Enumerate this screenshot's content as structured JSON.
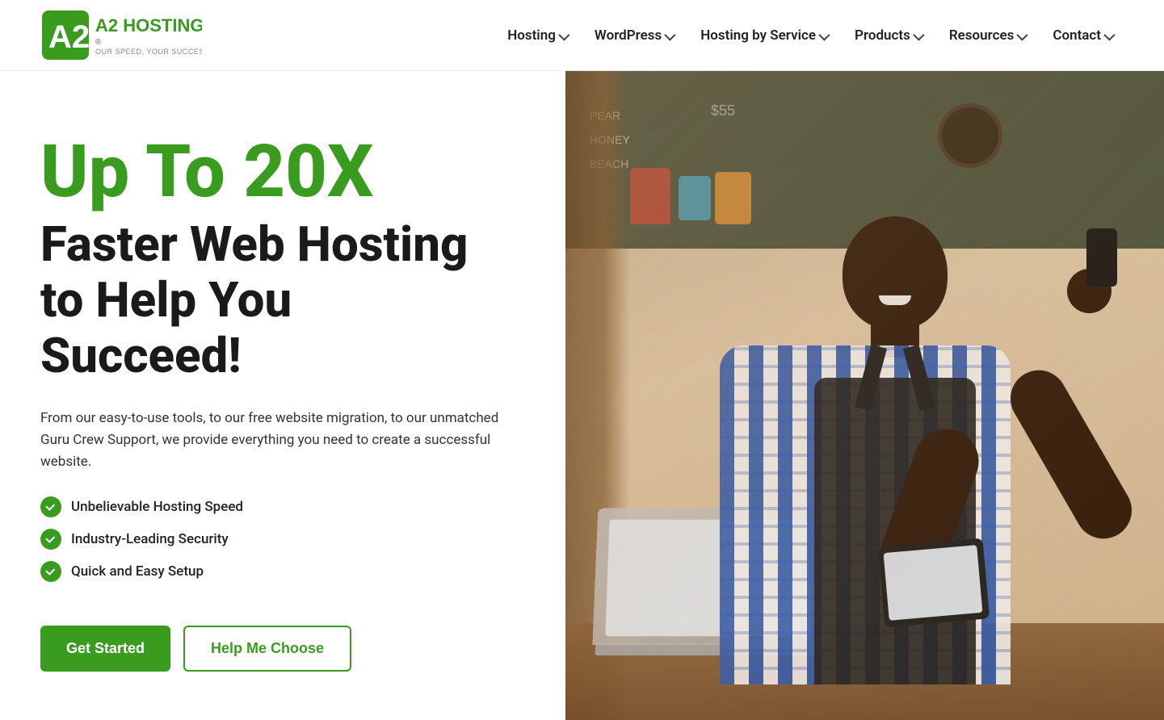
{
  "brand": {
    "name": "A2 Hosting",
    "tagline": "OUR SPEED, YOUR SUCCESS",
    "logo_text": "A2 HOSTING"
  },
  "nav": {
    "items": [
      {
        "id": "hosting",
        "label": "Hosting",
        "has_dropdown": true
      },
      {
        "id": "wordpress",
        "label": "WordPress",
        "has_dropdown": true
      },
      {
        "id": "hosting_by_service",
        "label": "Hosting by Service",
        "has_dropdown": true
      },
      {
        "id": "products",
        "label": "Products",
        "has_dropdown": true
      },
      {
        "id": "resources",
        "label": "Resources",
        "has_dropdown": true
      },
      {
        "id": "contact",
        "label": "Contact",
        "has_dropdown": true
      }
    ]
  },
  "hero": {
    "headline_top": "Up To 20X",
    "headline_bottom": "Faster Web Hosting\nto Help You\nSucceed!",
    "description": "From our easy-to-use tools, to our free website migration, to our unmatched Guru Crew Support, we provide everything you need to create a successful website.",
    "features": [
      {
        "id": "speed",
        "text": "Unbelievable Hosting Speed"
      },
      {
        "id": "security",
        "text": "Industry-Leading Security"
      },
      {
        "id": "setup",
        "text": "Quick and Easy Setup"
      }
    ],
    "button_primary": "Get Started",
    "button_secondary": "Help Me Choose"
  },
  "colors": {
    "green": "#3a9c1f",
    "dark": "#1a1a1a",
    "text": "#333333"
  }
}
